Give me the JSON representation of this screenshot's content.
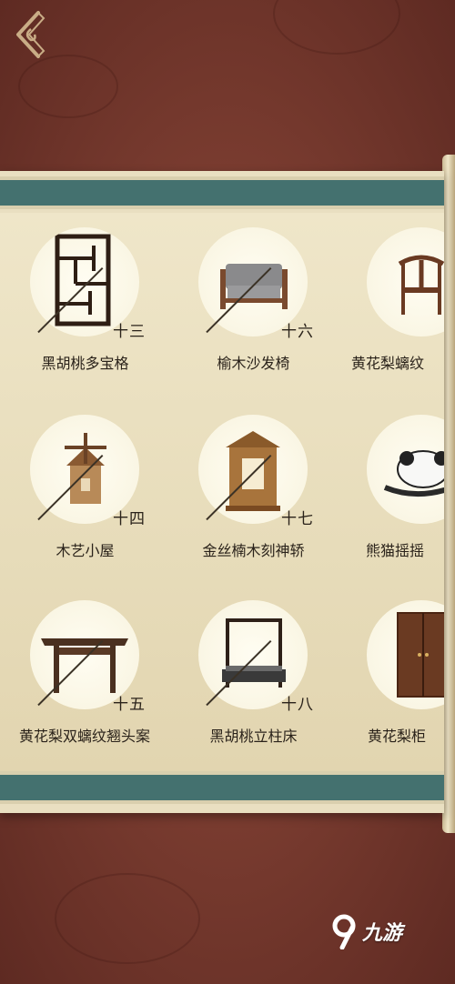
{
  "items": [
    {
      "label": "黑胡桃多宝格",
      "number": "十三",
      "icon": "bookshelf-icon"
    },
    {
      "label": "榆木沙发椅",
      "number": "十六",
      "icon": "armchair-icon"
    },
    {
      "label": "黄花梨螭纹",
      "number": "",
      "icon": "chair-icon"
    },
    {
      "label": "木艺小屋",
      "number": "十四",
      "icon": "windmill-house-icon"
    },
    {
      "label": "金丝楠木刻神轿",
      "number": "十七",
      "icon": "sedan-chair-icon"
    },
    {
      "label": "熊猫摇摇",
      "number": "",
      "icon": "panda-rocker-icon"
    },
    {
      "label": "黄花梨双螭纹翘头案",
      "number": "十五",
      "icon": "altar-table-icon"
    },
    {
      "label": "黑胡桃立柱床",
      "number": "十八",
      "icon": "canopy-bed-icon"
    },
    {
      "label": "黄花梨柜",
      "number": "",
      "icon": "cabinet-icon"
    }
  ],
  "watermark": {
    "text": "九游",
    "icon": "9-logo-icon"
  },
  "colors": {
    "band": "#44716f",
    "paper": "#e9dfc1",
    "background": "#7a3c30"
  }
}
